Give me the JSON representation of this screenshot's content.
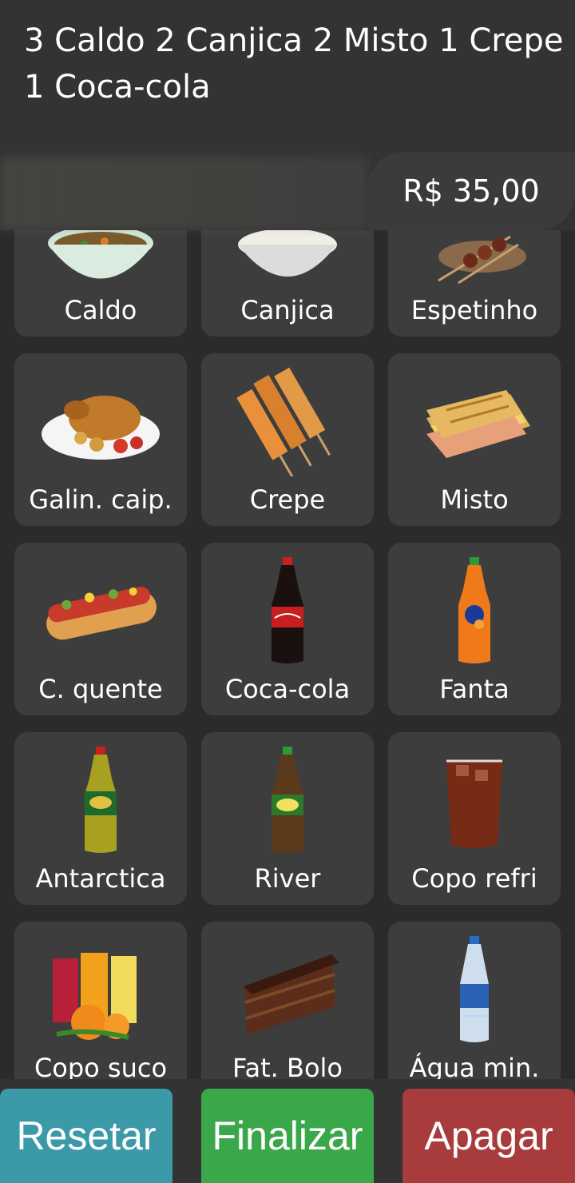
{
  "order": {
    "summary": "3 Caldo 2 Canjica 2 Misto 1 Crepe 1 Coca-cola",
    "total": "R$ 35,00"
  },
  "products": [
    {
      "label": "Caldo",
      "icon": "soup-bowl-icon"
    },
    {
      "label": "Canjica",
      "icon": "white-bowl-icon"
    },
    {
      "label": "Espetinho",
      "icon": "skewer-icon"
    },
    {
      "label": "Galin. caip.",
      "icon": "roast-chicken-icon"
    },
    {
      "label": "Crepe",
      "icon": "crepe-stick-icon"
    },
    {
      "label": "Misto",
      "icon": "toasted-sandwich-icon"
    },
    {
      "label": "C. quente",
      "icon": "hotdog-icon"
    },
    {
      "label": "Coca-cola",
      "icon": "coca-cola-bottle-icon"
    },
    {
      "label": "Fanta",
      "icon": "fanta-bottle-icon"
    },
    {
      "label": "Antarctica",
      "icon": "guarana-bottle-icon"
    },
    {
      "label": "River",
      "icon": "river-bottle-icon"
    },
    {
      "label": "Copo refri",
      "icon": "soda-glass-icon"
    },
    {
      "label": "Copo suco",
      "icon": "juice-glasses-icon"
    },
    {
      "label": "Fat. Bolo",
      "icon": "cake-slice-icon"
    },
    {
      "label": "Água min.",
      "icon": "water-bottle-icon"
    }
  ],
  "actions": {
    "reset": "Resetar",
    "finish": "Finalizar",
    "delete": "Apagar"
  },
  "colors": {
    "reset": "#3b99a8",
    "finish": "#3aa84a",
    "delete": "#a83b3b"
  }
}
